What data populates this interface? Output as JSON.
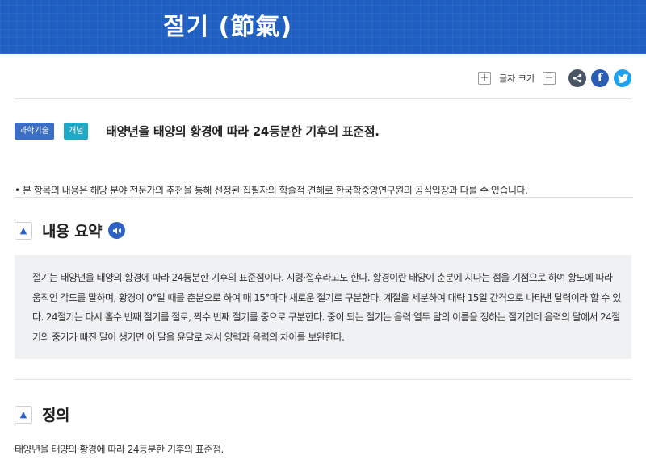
{
  "header": {
    "title": "절기 (節氣)"
  },
  "toolbar": {
    "increase_label": "+",
    "font_size_label": "글자 크기",
    "decrease_label": "−",
    "facebook_glyph": "f"
  },
  "article": {
    "tags": [
      "과학기술",
      "개념"
    ],
    "headline": "태양년을 태양의 황경에 따라 24등분한 기후의 표준점.",
    "note": "• 본 항목의 내용은 해당 분야 전문가의 추천을 통해 선정된 집필자의 학술적 견해로 한국학중앙연구원의 공식입장과 다를 수 있습니다."
  },
  "summary": {
    "heading": "내용 요약",
    "body": "절기는 태양년을 태양의 황경에 따라 24등분한 기후의 표준점이다. 시령·절후라고도 한다. 황경이란 태양이 춘분에 지나는 점을 기점으로 하여 황도에 따라 움직인 각도를 말하며, 황경이 0°일 때를 춘분으로 하여 매 15°마다 새로운 절기로 구분한다. 계절을 세분하여 대략 15일 간격으로 나타낸 달력이라 할 수 있다. 24절기는 다시 홀수 번째 절기를 절로, 짝수 번째 절기를 중으로 구분한다. 중이 되는 절기는 음력 열두 달의 이름을 정하는 절기인데 음력의 달에서 24절기의 중기가 빠진 달이 생기면 이 달을 윤달로 쳐서 양력과 음력의 차이를 보완한다."
  },
  "definition": {
    "heading": "정의",
    "body": "태양년을 태양의 황경에 따라 24등분한 기후의 표준점."
  },
  "colors": {
    "banner": "#1f5fc2",
    "accent": "#2d62c4",
    "tag1": "#3a6fc5",
    "tag2": "#20a9c6"
  },
  "icons": [
    "plus-icon",
    "minus-icon",
    "share-icon",
    "facebook-icon",
    "twitter-icon",
    "chevron-up-icon",
    "speaker-icon"
  ]
}
